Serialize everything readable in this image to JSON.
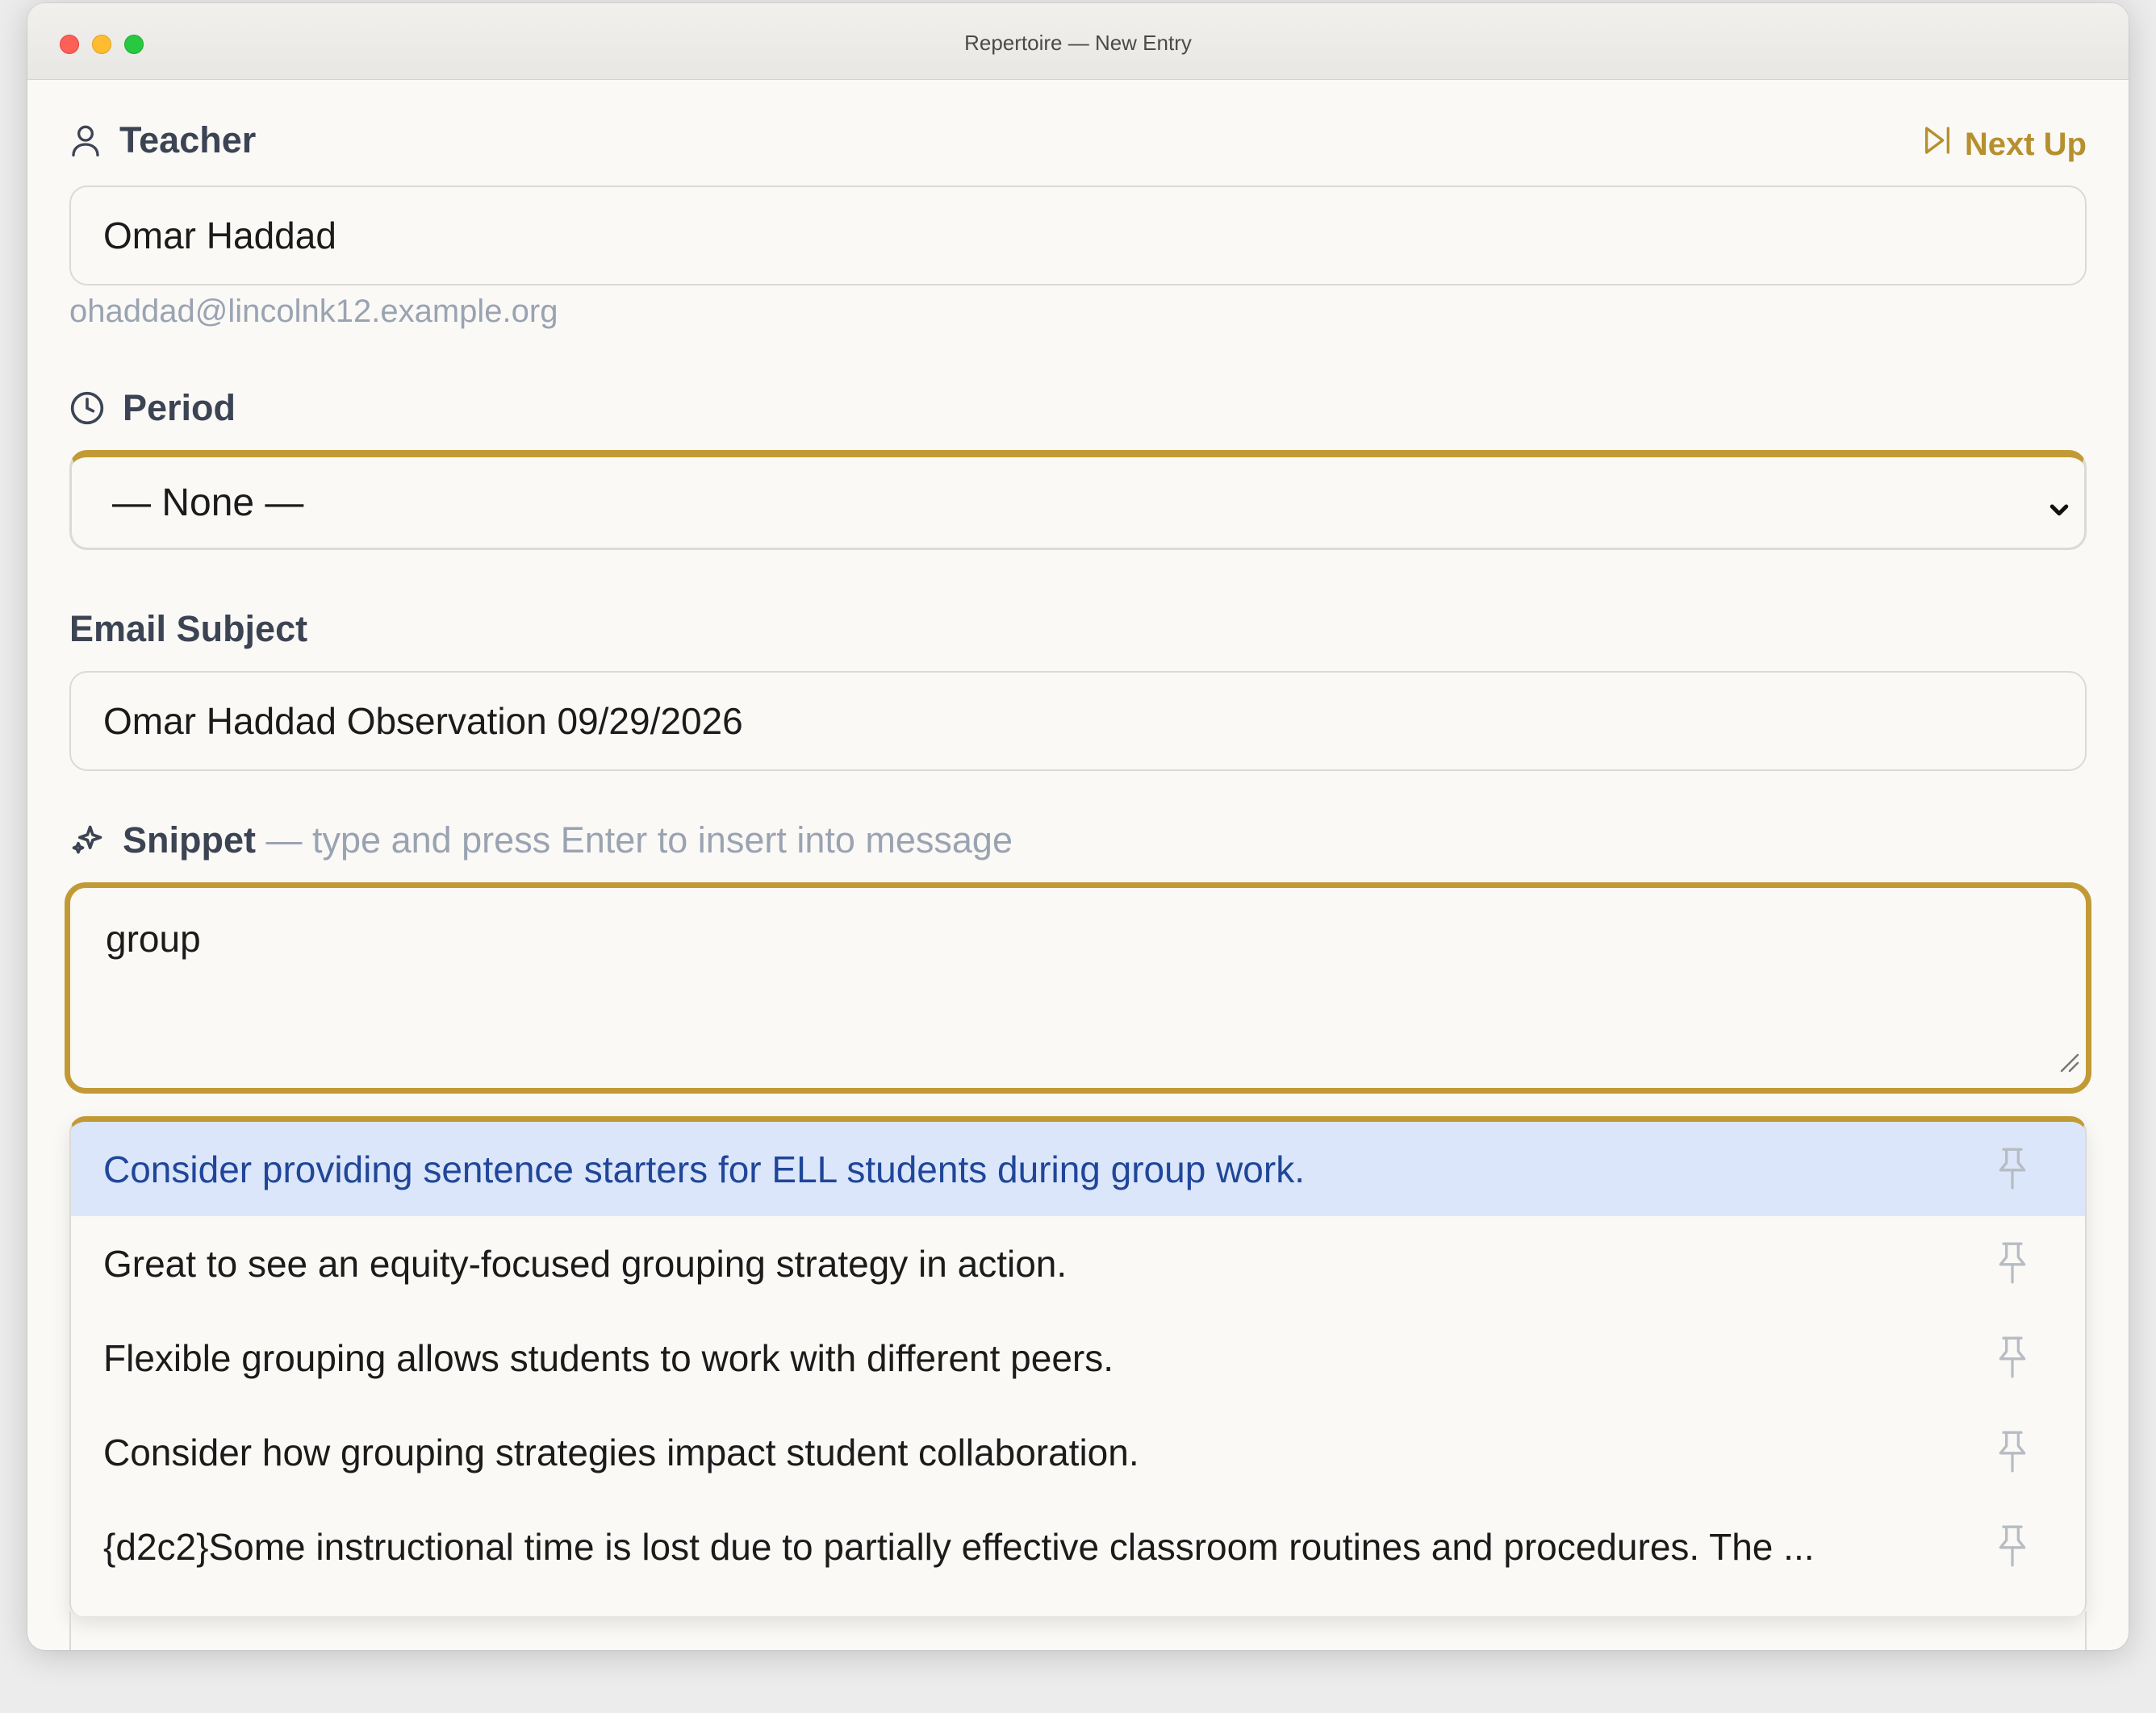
{
  "window": {
    "title": "Repertoire — New Entry"
  },
  "teacher": {
    "label": "Teacher",
    "value": "Omar Haddad",
    "email": "ohaddad@lincolnk12.example.org"
  },
  "next_up": {
    "label": "Next Up"
  },
  "period": {
    "label": "Period",
    "selected": "— None —"
  },
  "email_subject": {
    "label": "Email Subject",
    "value": "Omar Haddad Observation 09/29/2026"
  },
  "snippet": {
    "label": "Snippet",
    "hint": "— type and press Enter to insert into message",
    "value": "group"
  },
  "suggestions": [
    "Consider providing sentence starters for ELL students during group work.",
    "Great to see an equity-focused grouping strategy in action.",
    "Flexible grouping allows students to work with different peers.",
    "Consider how grouping strategies impact student collaboration.",
    "{d2c2}Some instructional time is lost due to partially effective classroom routines and procedures. The ..."
  ],
  "colors": {
    "accent": "#c29a35",
    "highlight": "#dbe6fa",
    "highlight_text": "#1f4699",
    "muted": "#9aa3b2"
  },
  "icons": {
    "teacher": "person-icon",
    "next_up": "skip-forward-icon",
    "period": "clock-icon",
    "snippet": "sparkles-icon",
    "row_action": "pin-icon",
    "select": "chevron-down-icon"
  }
}
